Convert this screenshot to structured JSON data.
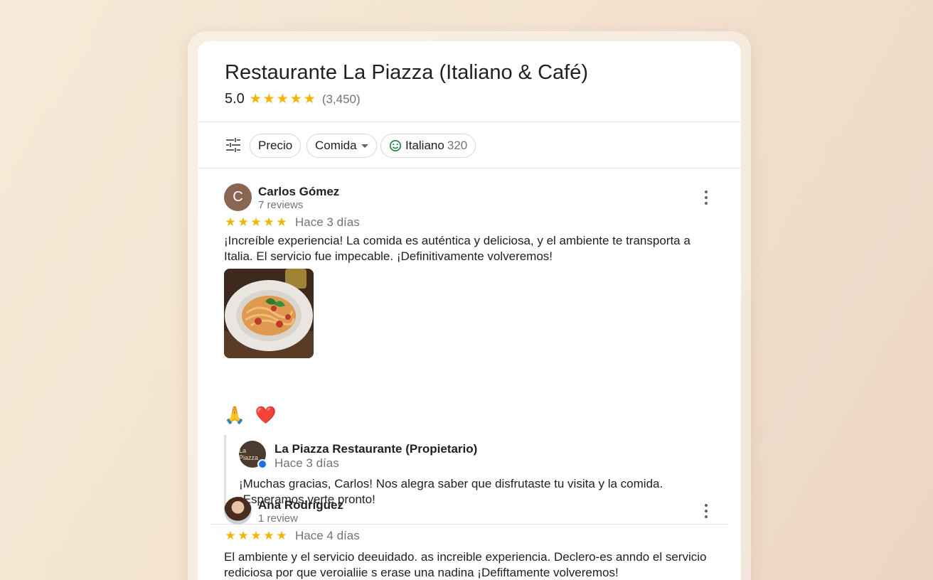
{
  "place": {
    "title": "Restaurante La Piazza (Italiano & Café)",
    "rating": "5.0",
    "review_count": "(3,450)"
  },
  "filters": {
    "icon": "tune-icon",
    "chips": [
      {
        "label": "Precio"
      },
      {
        "label": "Comida"
      },
      {
        "label": "Italiano",
        "count": "320"
      }
    ]
  },
  "reviews": [
    {
      "avatar_letter": "C",
      "author": "Carlos Gómez",
      "author_reviews": "7 reviews",
      "stars": 5,
      "date": "Hace 3 días",
      "text": "¡Increíble experiencia! La comida es auténtica y deliciosa, y el ambiente te transporta a Italia. El servicio fue impecable. ¡Definitivamente volveremos!",
      "reactions": [
        "🙏",
        "❤️"
      ],
      "reply": {
        "avatar_text": "La Piazza",
        "author": "La Piazza Restaurante (Propietario)",
        "date": "Hace 3 días",
        "text": "¡Muchas gracias, Carlos! Nos alegra saber que disfrutaste tu visita y la comida. ¡Esperamos verte pronto!"
      }
    },
    {
      "author": "Ana Rodríguez",
      "author_reviews": "1 review",
      "stars": 5,
      "date": "Hace 4 días",
      "text": "El ambiente y el servicio deeuidado. as increible experiencia. Declero-es anndo el servicio rediciosa por que veroialiie s erase una nadina ¡Defiftamente volveremos!"
    }
  ],
  "colors": {
    "star": "#f4b400",
    "verified": "#1a73e8",
    "smile": "#188038"
  }
}
